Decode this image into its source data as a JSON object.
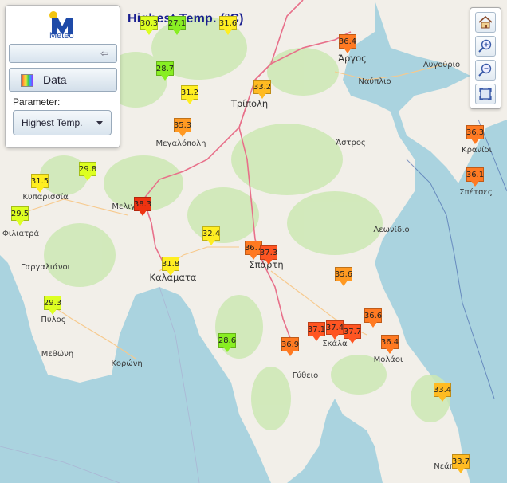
{
  "app": {
    "logo_text": "Meteo",
    "title": "Highest Temp. (°C)"
  },
  "panel": {
    "data_button": "Data",
    "parameter_label": "Parameter:",
    "parameter_value": "Highest Temp."
  },
  "toolbar": {
    "tools": [
      "home-icon",
      "zoom-in-icon",
      "zoom-out-icon",
      "fullscreen-icon"
    ]
  },
  "places": [
    "Άργος",
    "Τρίπολη",
    "Ναύπλιο",
    "Λυγούριο",
    "Μεγαλόπολη",
    "Άστρος",
    "Κρανίδι",
    "Σπέτσες",
    "Κυπαρισσία",
    "Μελιγ",
    "Φιλιατρά",
    "Λεωνίδιο",
    "Γαργαλιάνοι",
    "Καλαματα",
    "Σπάρτη",
    "Πύλος",
    "Μεθώνη",
    "Κορώνη",
    "Σκάλα",
    "Μολάοι",
    "Γύθειο",
    "Νεάπ"
  ],
  "readings": [
    "30.3",
    "27.1",
    "31.6",
    "36.4",
    "28.7",
    "31.2",
    "33.2",
    "35.3",
    "36.3",
    "36.1",
    "29.8",
    "31.5",
    "38.3",
    "29.5",
    "32.4",
    "36.7",
    "37.3",
    "31.8",
    "35.6",
    "29.3",
    "36.6",
    "37.1",
    "37.4",
    "37.7",
    "36.4",
    "36.9",
    "28.6",
    "33.4",
    "33.7"
  ],
  "colors": {
    "sea": "#aad3df",
    "land": "#f2efe9",
    "forest": "#cde8b4",
    "road": "#e8708a",
    "title": "#1a1f8f",
    "temp_scale": {
      "27": "#88ee22",
      "29": "#ddff22",
      "31": "#ffee22",
      "33": "#ffbb22",
      "35": "#ff9922",
      "36": "#ff7a22",
      "37": "#ff5522",
      "38": "#ee3311"
    }
  }
}
